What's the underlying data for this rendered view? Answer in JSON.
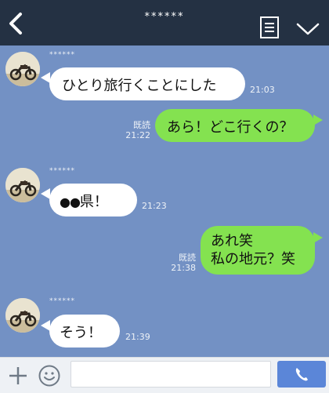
{
  "header": {
    "title": "******",
    "back_icon": "chevron-left-icon",
    "menu_icon": "document-list-icon",
    "collapse_icon": "chevron-down-icon",
    "background": "#243143"
  },
  "chat": {
    "background": "#7391c4",
    "messages": [
      {
        "side": "in",
        "sender": "******",
        "text": "ひとり旅行くことにした",
        "time": "21:03"
      },
      {
        "side": "out",
        "text": "あら！どこ行くの？",
        "read": "既読",
        "time": "21:22"
      },
      {
        "side": "in",
        "sender": "******",
        "text": "県！",
        "prefix_symbol": "●●",
        "time": "21:23"
      },
      {
        "side": "out",
        "line1": "あれ笑",
        "line2": "私の地元？笑",
        "read": "既読",
        "time": "21:38"
      },
      {
        "side": "in",
        "sender": "******",
        "text": "そう！",
        "time": "21:39"
      }
    ],
    "incoming_bubble_color": "#ffffff",
    "outgoing_bubble_color": "#84e250"
  },
  "input_bar": {
    "placeholder": "",
    "value": "",
    "plus_icon": "plus-icon",
    "emoji_icon": "smiley-icon",
    "call_icon": "phone-icon",
    "call_button_color": "#5b86d8"
  }
}
